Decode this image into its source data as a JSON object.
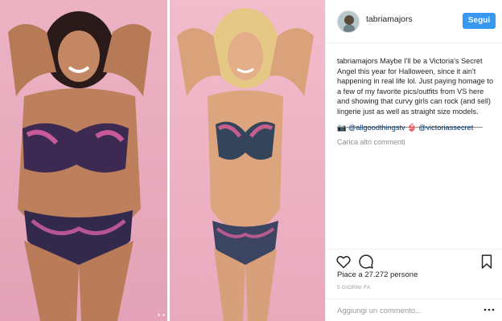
{
  "post": {
    "username": "tabriamajors",
    "follow_label": "Segui",
    "caption_user": "tabriamajors",
    "caption_text": "Maybe I'll be a Victoria's Secret Angel this year for Halloween, since it ain't happening in real life lol. Just paying homage to a few of my favorite pics/outfits from VS here and showing that curvy girls can rock (and sell) lingerie just as well as straight size models.",
    "caption_divider": "________________________________________",
    "mention_camera_icon": "📷",
    "mention_1": "@allgoodthingstv",
    "mention_bra_icon": "👙",
    "mention_2": "@victoriassecret",
    "load_more": "Carica altri commenti",
    "likes": "Piace a 27.272 persone",
    "timestamp": "5 GIORNI FA",
    "comment_placeholder": "Aggiungi un commento..."
  },
  "icons": {
    "like": "heart-icon",
    "comment": "comment-icon",
    "save": "bookmark-icon",
    "more": "more-options-icon"
  },
  "colors": {
    "follow_button": "#3897f0",
    "photo_background": "#e8aec1",
    "link": "#003569"
  }
}
